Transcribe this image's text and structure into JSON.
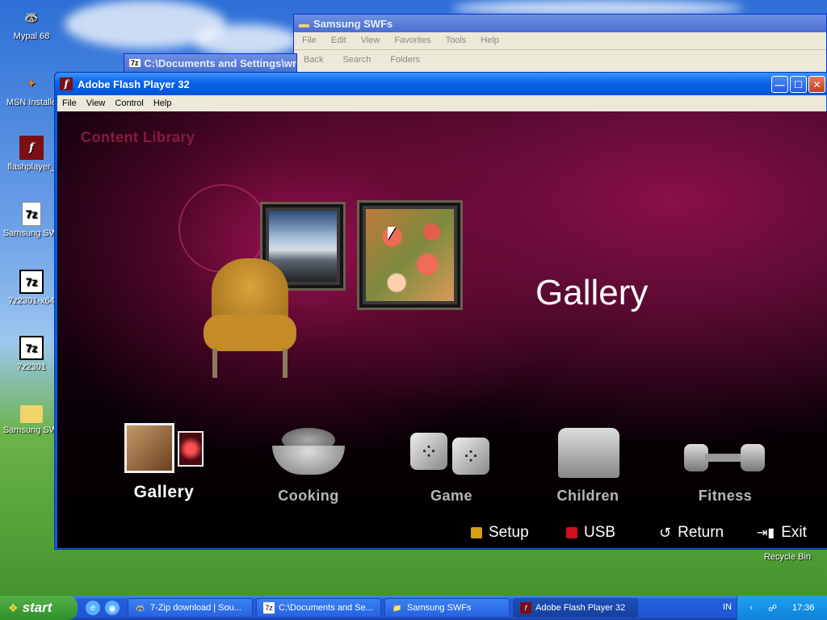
{
  "desktop": {
    "icons": [
      {
        "label": "Mypal 68",
        "glyph": "🦝"
      },
      {
        "label": "MSN Installe",
        "glyph": "✦"
      },
      {
        "label": "flashplayer_",
        "glyph": "f"
      },
      {
        "label": "Samsung SWI",
        "glyph": "7z"
      },
      {
        "label": "7z2301-x64",
        "glyph": "7z"
      },
      {
        "label": "7z2301",
        "glyph": "7z"
      },
      {
        "label": "Samsung SWI",
        "glyph": ""
      }
    ],
    "recycle_bin_label": "Recycle Bin"
  },
  "bg_windows": {
    "explorer": {
      "title": "Samsung SWFs",
      "menu": [
        "File",
        "Edit",
        "View",
        "Favorites",
        "Tools",
        "Help"
      ],
      "toolbar": [
        "Back",
        "Search",
        "Folders"
      ]
    },
    "cmd": {
      "title": "C:\\Documents and Settings\\wm"
    }
  },
  "flash_window": {
    "title": "Adobe Flash Player 32",
    "menu": [
      "File",
      "View",
      "Control",
      "Help"
    ],
    "buttons": {
      "minimize": "—",
      "maximize": "☐",
      "close": "✕"
    }
  },
  "stage": {
    "header": "Content Library",
    "big_title": "Gallery",
    "categories": [
      {
        "label": "Gallery",
        "active": true
      },
      {
        "label": "Cooking",
        "active": false
      },
      {
        "label": "Game",
        "active": false
      },
      {
        "label": "Children",
        "active": false
      },
      {
        "label": "Fitness",
        "active": false
      }
    ],
    "controls": {
      "setup": "Setup",
      "usb": "USB",
      "return": "Return",
      "exit": "Exit"
    },
    "colors": {
      "setup": "#d4a017",
      "usb": "#d0101c",
      "accent": "#8a1a3a"
    }
  },
  "taskbar": {
    "start": "start",
    "tasks": [
      {
        "label": "7-Zip download | Sou...",
        "icon": "🦝"
      },
      {
        "label": "C:\\Documents and Se...",
        "icon": "7z"
      },
      {
        "label": "Samsung SWFs",
        "icon": "📁"
      },
      {
        "label": "Adobe Flash Player 32",
        "icon": "f"
      }
    ],
    "language": "IN",
    "time": "17:36"
  }
}
